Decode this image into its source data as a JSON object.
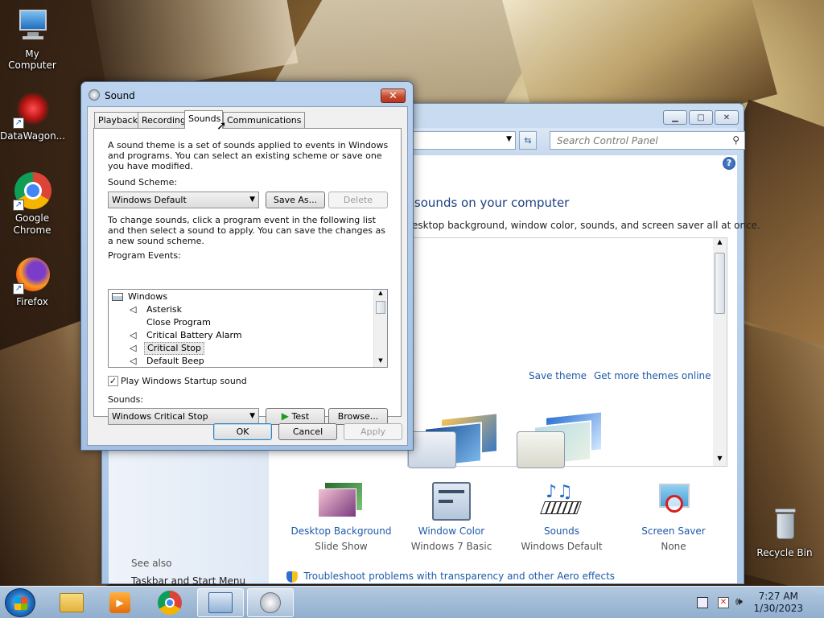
{
  "desktop": {
    "icons": [
      {
        "label": "My Computer"
      },
      {
        "label": "DataWagon..."
      },
      {
        "label": "Google Chrome"
      },
      {
        "label": "Firefox"
      },
      {
        "label": "Recycle Bin"
      }
    ]
  },
  "control_panel": {
    "search_placeholder": "Search Control Panel",
    "heading": "l sounds on your computer",
    "subheading": "esktop background, window color, sounds, and screen saver all at once.",
    "save_theme": "Save theme",
    "get_more_themes": "Get more themes online",
    "see_also": "See also",
    "taskbar_link": "Taskbar and Start Menu",
    "tiles": [
      {
        "title": "Desktop Background",
        "value": "Slide Show"
      },
      {
        "title": "Window Color",
        "value": "Windows 7 Basic"
      },
      {
        "title": "Sounds",
        "value": "Windows Default"
      },
      {
        "title": "Screen Saver",
        "value": "None"
      }
    ],
    "troubleshoot": "Troubleshoot problems with transparency and other Aero effects"
  },
  "sound_dialog": {
    "title": "Sound",
    "close": "✕",
    "tabs": [
      "Playback",
      "Recording",
      "Sounds",
      "Communications"
    ],
    "active_tab": "Sounds",
    "intro": "A sound theme is a set of sounds applied to events in Windows and programs.  You can select an existing scheme or save one you have modified.",
    "scheme_label": "Sound Scheme:",
    "scheme_value": "Windows Default",
    "save_as": "Save As...",
    "delete": "Delete",
    "change_text": "To change sounds, click a program event in the following list and then select a sound to apply.  You can save the changes as a new sound scheme.",
    "events_label": "Program Events:",
    "events": [
      {
        "label": "Windows",
        "group": true,
        "speaker": false
      },
      {
        "label": "Asterisk",
        "group": false,
        "speaker": true
      },
      {
        "label": "Close Program",
        "group": false,
        "speaker": false
      },
      {
        "label": "Critical Battery Alarm",
        "group": false,
        "speaker": true
      },
      {
        "label": "Critical Stop",
        "group": false,
        "speaker": true,
        "selected": true
      },
      {
        "label": "Default Beep",
        "group": false,
        "speaker": true
      }
    ],
    "startup_label": "Play Windows Startup sound",
    "startup_checked": true,
    "sounds_label": "Sounds:",
    "sound_value": "Windows Critical Stop",
    "test": "Test",
    "browse": "Browse...",
    "ok": "OK",
    "cancel": "Cancel",
    "apply": "Apply"
  },
  "taskbar": {
    "time": "7:27 AM",
    "date": "1/30/2023"
  }
}
